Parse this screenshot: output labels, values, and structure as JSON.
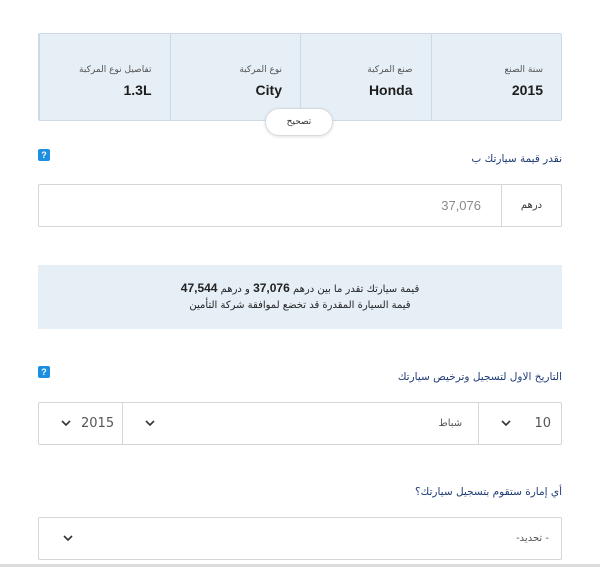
{
  "vehicle": {
    "fields": [
      {
        "label": "سنة الصنع",
        "value": "2015"
      },
      {
        "label": "صنع المركبة",
        "value": "Honda"
      },
      {
        "label": "نوع المركبة",
        "value": "City"
      },
      {
        "label": "تفاصيل نوع المركبة",
        "value": "1.3L"
      }
    ],
    "edit_label": "تصحيح"
  },
  "help_glyph": "?",
  "estimate": {
    "question": "نقدر قيمة سيارتك ب",
    "unit": "درهم",
    "value": "37,076"
  },
  "info": {
    "line1_prefix": "قيمة سيارتك تقدر ما بين درهم",
    "min": "37,076",
    "line1_mid": "و درهم",
    "max": "47,544",
    "line2": "قيمة السيارة المقدرة قد تخضع لموافقة شركة التأمين"
  },
  "registration": {
    "question": "التاريخ الاول لتسجيل وترخيص سيارتك",
    "day": "10",
    "month": "شباط",
    "year": "2015"
  },
  "emirate": {
    "question": "أي إمارة ستقوم بتسجيل سيارتك؟",
    "placeholder": "-تحديد -"
  },
  "colors": {
    "panel": "#e6eff6",
    "link": "#1f3c78",
    "help": "#1d8fe1"
  },
  "icons": [
    "help-icon",
    "chevron-down-icon"
  ]
}
